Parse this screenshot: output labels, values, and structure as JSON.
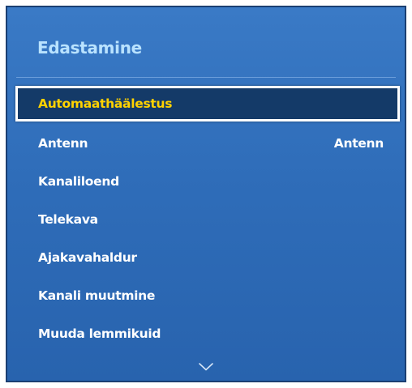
{
  "menu": {
    "title": "Edastamine",
    "items": [
      {
        "label": "Automaathäälestus",
        "value": "",
        "selected": true
      },
      {
        "label": "Antenn",
        "value": "Antenn",
        "selected": false
      },
      {
        "label": "Kanaliloend",
        "value": "",
        "selected": false
      },
      {
        "label": "Telekava",
        "value": "",
        "selected": false
      },
      {
        "label": "Ajakavahaldur",
        "value": "",
        "selected": false
      },
      {
        "label": "Kanali muutmine",
        "value": "",
        "selected": false
      },
      {
        "label": "Muuda lemmikuid",
        "value": "",
        "selected": false
      }
    ],
    "scroll_icon": "chevron-down-icon"
  },
  "colors": {
    "panel_bg": "#2f6db9",
    "title": "#b9e2ff",
    "selected_bg": "#143a68",
    "selected_text": "#ffd200",
    "text": "#ffffff"
  }
}
